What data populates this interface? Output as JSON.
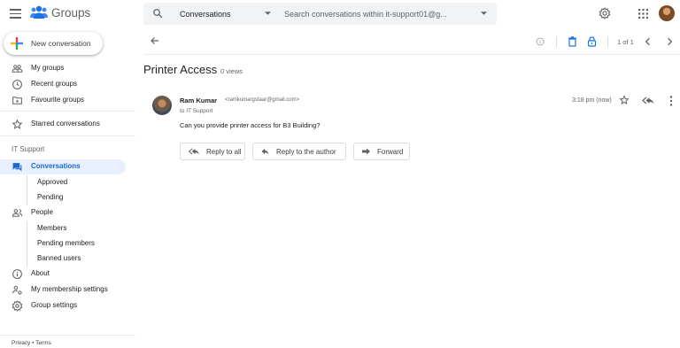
{
  "app": {
    "name": "Groups"
  },
  "search": {
    "scope_label": "Conversations",
    "placeholder": "Search conversations within it-support01@g..."
  },
  "sidebar": {
    "new_conversation_label": "New conversation",
    "top_items": [
      {
        "label": "My groups",
        "icon": "groups-icon"
      },
      {
        "label": "Recent groups",
        "icon": "clock-icon"
      },
      {
        "label": "Favourite groups",
        "icon": "folder-star-icon"
      }
    ],
    "starred_label": "Starred conversations",
    "group_title": "IT Support",
    "group_items": {
      "conversations": "Conversations",
      "approved": "Approved",
      "pending": "Pending",
      "people": "People",
      "members": "Members",
      "pending_members": "Pending members",
      "banned_users": "Banned users",
      "about": "About",
      "membership_settings": "My membership settings",
      "group_settings": "Group settings"
    },
    "footer": {
      "privacy": "Privacy",
      "separator": " • ",
      "terms": "Terms"
    }
  },
  "toolbar": {
    "page_count": "1 of 1"
  },
  "conversation": {
    "title": "Printer Access",
    "views": "0 views",
    "message": {
      "author": "Ram Kumar",
      "email": "<ramkumargstaar@gmail.com>",
      "to": "to IT Support",
      "time": "3:18 pm (now)",
      "body": "Can you provide printer access for B3 Building?"
    },
    "actions": {
      "reply_all": "Reply to all",
      "reply_author": "Reply to the author",
      "forward": "Forward"
    }
  },
  "colors": {
    "accent": "#1a73e8",
    "active_nav_bg": "#e8f0fe",
    "active_nav_text": "#1967d2",
    "search_bg": "#f1f3f4",
    "icon_gray": "#5f6368"
  }
}
